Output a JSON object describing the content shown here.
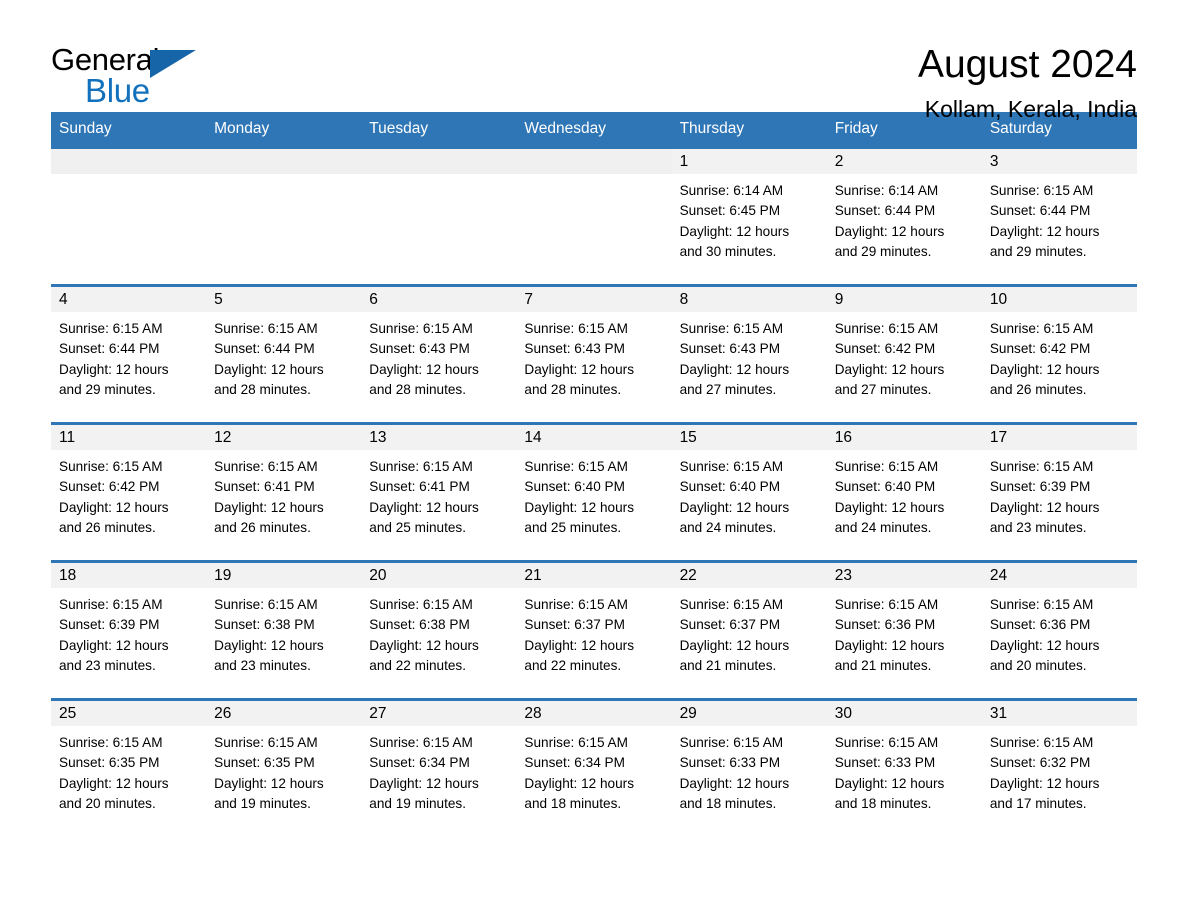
{
  "brand": {
    "word_general": "General",
    "word_blue": "Blue",
    "triangle_icon": "brand-triangle-icon",
    "triangle_color": "#1565a8",
    "blue_text_color": "#1271bd"
  },
  "header": {
    "title": "August 2024",
    "subtitle": "Kollam, Kerala, India"
  },
  "colors": {
    "header_bar": "#2e76b6",
    "date_band": "#f2f2f2",
    "week_rule": "#2e76b6",
    "text": "#000000",
    "header_text": "#ffffff"
  },
  "weekdays": [
    "Sunday",
    "Monday",
    "Tuesday",
    "Wednesday",
    "Thursday",
    "Friday",
    "Saturday"
  ],
  "weeks": [
    {
      "days": [
        {
          "date": "",
          "empty": true
        },
        {
          "date": "",
          "empty": true
        },
        {
          "date": "",
          "empty": true
        },
        {
          "date": "",
          "empty": true
        },
        {
          "date": "1",
          "sunrise": "Sunrise: 6:14 AM",
          "sunset": "Sunset: 6:45 PM",
          "daylight_1": "Daylight: 12 hours",
          "daylight_2": "and 30 minutes."
        },
        {
          "date": "2",
          "sunrise": "Sunrise: 6:14 AM",
          "sunset": "Sunset: 6:44 PM",
          "daylight_1": "Daylight: 12 hours",
          "daylight_2": "and 29 minutes."
        },
        {
          "date": "3",
          "sunrise": "Sunrise: 6:15 AM",
          "sunset": "Sunset: 6:44 PM",
          "daylight_1": "Daylight: 12 hours",
          "daylight_2": "and 29 minutes."
        }
      ]
    },
    {
      "days": [
        {
          "date": "4",
          "sunrise": "Sunrise: 6:15 AM",
          "sunset": "Sunset: 6:44 PM",
          "daylight_1": "Daylight: 12 hours",
          "daylight_2": "and 29 minutes."
        },
        {
          "date": "5",
          "sunrise": "Sunrise: 6:15 AM",
          "sunset": "Sunset: 6:44 PM",
          "daylight_1": "Daylight: 12 hours",
          "daylight_2": "and 28 minutes."
        },
        {
          "date": "6",
          "sunrise": "Sunrise: 6:15 AM",
          "sunset": "Sunset: 6:43 PM",
          "daylight_1": "Daylight: 12 hours",
          "daylight_2": "and 28 minutes."
        },
        {
          "date": "7",
          "sunrise": "Sunrise: 6:15 AM",
          "sunset": "Sunset: 6:43 PM",
          "daylight_1": "Daylight: 12 hours",
          "daylight_2": "and 28 minutes."
        },
        {
          "date": "8",
          "sunrise": "Sunrise: 6:15 AM",
          "sunset": "Sunset: 6:43 PM",
          "daylight_1": "Daylight: 12 hours",
          "daylight_2": "and 27 minutes."
        },
        {
          "date": "9",
          "sunrise": "Sunrise: 6:15 AM",
          "sunset": "Sunset: 6:42 PM",
          "daylight_1": "Daylight: 12 hours",
          "daylight_2": "and 27 minutes."
        },
        {
          "date": "10",
          "sunrise": "Sunrise: 6:15 AM",
          "sunset": "Sunset: 6:42 PM",
          "daylight_1": "Daylight: 12 hours",
          "daylight_2": "and 26 minutes."
        }
      ]
    },
    {
      "days": [
        {
          "date": "11",
          "sunrise": "Sunrise: 6:15 AM",
          "sunset": "Sunset: 6:42 PM",
          "daylight_1": "Daylight: 12 hours",
          "daylight_2": "and 26 minutes."
        },
        {
          "date": "12",
          "sunrise": "Sunrise: 6:15 AM",
          "sunset": "Sunset: 6:41 PM",
          "daylight_1": "Daylight: 12 hours",
          "daylight_2": "and 26 minutes."
        },
        {
          "date": "13",
          "sunrise": "Sunrise: 6:15 AM",
          "sunset": "Sunset: 6:41 PM",
          "daylight_1": "Daylight: 12 hours",
          "daylight_2": "and 25 minutes."
        },
        {
          "date": "14",
          "sunrise": "Sunrise: 6:15 AM",
          "sunset": "Sunset: 6:40 PM",
          "daylight_1": "Daylight: 12 hours",
          "daylight_2": "and 25 minutes."
        },
        {
          "date": "15",
          "sunrise": "Sunrise: 6:15 AM",
          "sunset": "Sunset: 6:40 PM",
          "daylight_1": "Daylight: 12 hours",
          "daylight_2": "and 24 minutes."
        },
        {
          "date": "16",
          "sunrise": "Sunrise: 6:15 AM",
          "sunset": "Sunset: 6:40 PM",
          "daylight_1": "Daylight: 12 hours",
          "daylight_2": "and 24 minutes."
        },
        {
          "date": "17",
          "sunrise": "Sunrise: 6:15 AM",
          "sunset": "Sunset: 6:39 PM",
          "daylight_1": "Daylight: 12 hours",
          "daylight_2": "and 23 minutes."
        }
      ]
    },
    {
      "days": [
        {
          "date": "18",
          "sunrise": "Sunrise: 6:15 AM",
          "sunset": "Sunset: 6:39 PM",
          "daylight_1": "Daylight: 12 hours",
          "daylight_2": "and 23 minutes."
        },
        {
          "date": "19",
          "sunrise": "Sunrise: 6:15 AM",
          "sunset": "Sunset: 6:38 PM",
          "daylight_1": "Daylight: 12 hours",
          "daylight_2": "and 23 minutes."
        },
        {
          "date": "20",
          "sunrise": "Sunrise: 6:15 AM",
          "sunset": "Sunset: 6:38 PM",
          "daylight_1": "Daylight: 12 hours",
          "daylight_2": "and 22 minutes."
        },
        {
          "date": "21",
          "sunrise": "Sunrise: 6:15 AM",
          "sunset": "Sunset: 6:37 PM",
          "daylight_1": "Daylight: 12 hours",
          "daylight_2": "and 22 minutes."
        },
        {
          "date": "22",
          "sunrise": "Sunrise: 6:15 AM",
          "sunset": "Sunset: 6:37 PM",
          "daylight_1": "Daylight: 12 hours",
          "daylight_2": "and 21 minutes."
        },
        {
          "date": "23",
          "sunrise": "Sunrise: 6:15 AM",
          "sunset": "Sunset: 6:36 PM",
          "daylight_1": "Daylight: 12 hours",
          "daylight_2": "and 21 minutes."
        },
        {
          "date": "24",
          "sunrise": "Sunrise: 6:15 AM",
          "sunset": "Sunset: 6:36 PM",
          "daylight_1": "Daylight: 12 hours",
          "daylight_2": "and 20 minutes."
        }
      ]
    },
    {
      "days": [
        {
          "date": "25",
          "sunrise": "Sunrise: 6:15 AM",
          "sunset": "Sunset: 6:35 PM",
          "daylight_1": "Daylight: 12 hours",
          "daylight_2": "and 20 minutes."
        },
        {
          "date": "26",
          "sunrise": "Sunrise: 6:15 AM",
          "sunset": "Sunset: 6:35 PM",
          "daylight_1": "Daylight: 12 hours",
          "daylight_2": "and 19 minutes."
        },
        {
          "date": "27",
          "sunrise": "Sunrise: 6:15 AM",
          "sunset": "Sunset: 6:34 PM",
          "daylight_1": "Daylight: 12 hours",
          "daylight_2": "and 19 minutes."
        },
        {
          "date": "28",
          "sunrise": "Sunrise: 6:15 AM",
          "sunset": "Sunset: 6:34 PM",
          "daylight_1": "Daylight: 12 hours",
          "daylight_2": "and 18 minutes."
        },
        {
          "date": "29",
          "sunrise": "Sunrise: 6:15 AM",
          "sunset": "Sunset: 6:33 PM",
          "daylight_1": "Daylight: 12 hours",
          "daylight_2": "and 18 minutes."
        },
        {
          "date": "30",
          "sunrise": "Sunrise: 6:15 AM",
          "sunset": "Sunset: 6:33 PM",
          "daylight_1": "Daylight: 12 hours",
          "daylight_2": "and 18 minutes."
        },
        {
          "date": "31",
          "sunrise": "Sunrise: 6:15 AM",
          "sunset": "Sunset: 6:32 PM",
          "daylight_1": "Daylight: 12 hours",
          "daylight_2": "and 17 minutes."
        }
      ]
    }
  ]
}
